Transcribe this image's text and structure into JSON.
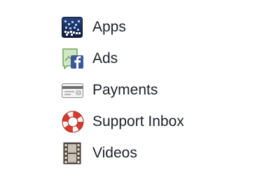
{
  "menu": {
    "items": [
      {
        "label": "Apps",
        "icon": "apps-grid-icon"
      },
      {
        "label": "Ads",
        "icon": "facebook-ads-icon"
      },
      {
        "label": "Payments",
        "icon": "credit-card-icon"
      },
      {
        "label": "Support Inbox",
        "icon": "life-preserver-icon"
      },
      {
        "label": "Videos",
        "icon": "film-strip-icon"
      }
    ]
  },
  "colors": {
    "text": "#1d2129",
    "apps_bg": "#1c2e5c",
    "facebook_blue": "#3b5998",
    "lifebuoy_red": "#d83b2e"
  }
}
